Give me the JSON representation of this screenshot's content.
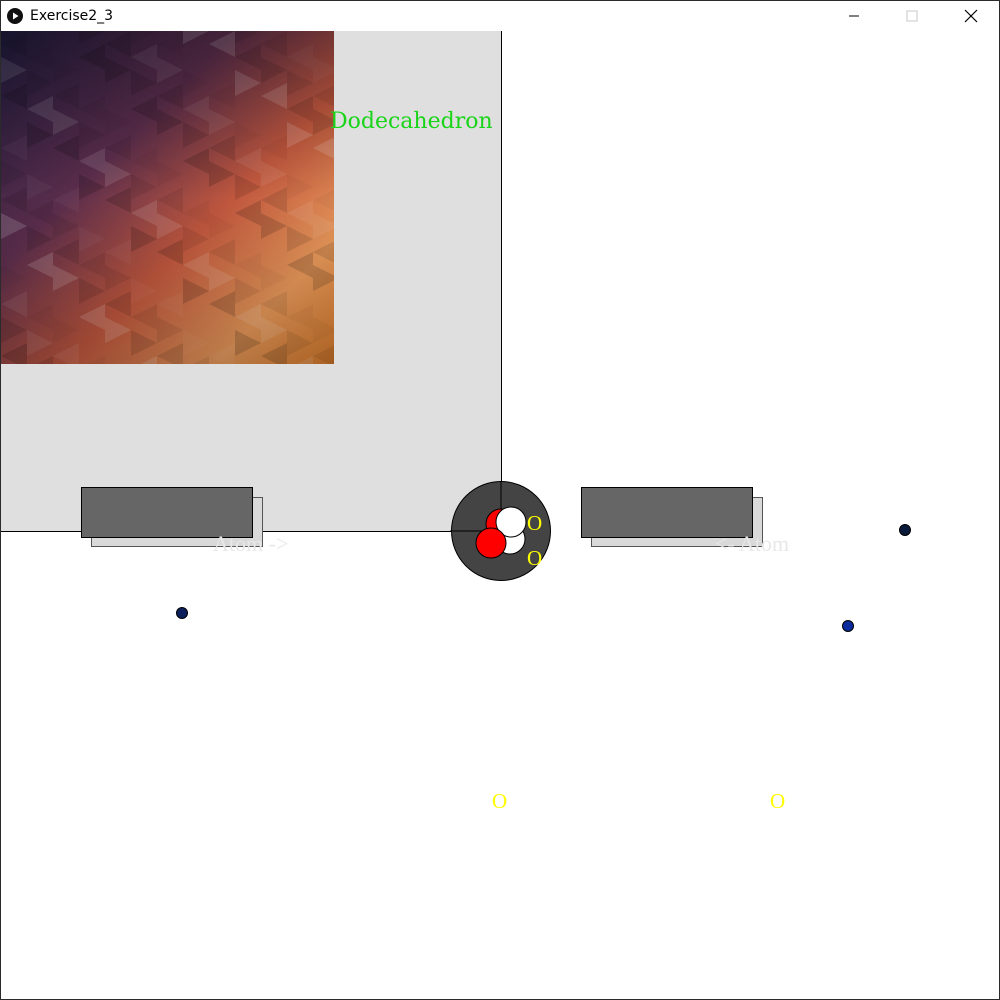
{
  "window": {
    "title": "Exercise2_3",
    "minimize_icon": "minimize-icon",
    "maximize_icon": "maximize-icon",
    "close_icon": "close-icon"
  },
  "scene": {
    "shape_label": "Dodecahedron",
    "shape_label_color": "#19d419",
    "left_button_label": "Atom ->",
    "right_button_label": "<- Atom",
    "atom_label_1": "O",
    "atom_label_2": "O",
    "floating_label_1": "O",
    "floating_label_2": "O",
    "label_yellow": "#ffff00",
    "dot_colors": [
      "#0a1f5c",
      "#0a1a3a",
      "#0b2a9c"
    ]
  }
}
